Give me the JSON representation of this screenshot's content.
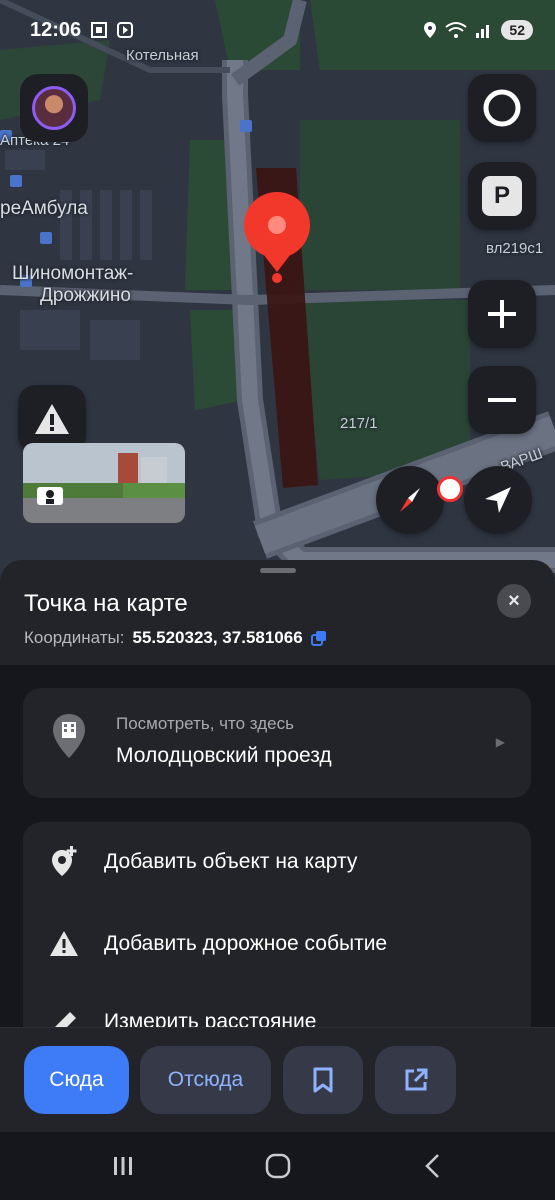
{
  "status_bar": {
    "time": "12:06",
    "battery": "52"
  },
  "map": {
    "labels": {
      "boiler": "Котельная",
      "pharmacy": "Аптека 24",
      "ambula": "реАмбула",
      "tire1": "Шиномонтаж-",
      "tire2": "Дрожжино",
      "building1": "вл219с1",
      "building2": "217/1",
      "road": "ВАРШ"
    },
    "colors": {
      "pin": "#f2372b",
      "highlight": "#3a1512"
    }
  },
  "sheet": {
    "title": "Точка на карте",
    "coords_label": "Координаты:",
    "coords_value": "55.520323, 37.581066",
    "close_label": "×",
    "what_here": {
      "subtitle": "Посмотреть, что здесь",
      "title": "Молодцовский проезд"
    },
    "actions": [
      {
        "label": "Добавить объект на карту",
        "icon": "add-place-icon"
      },
      {
        "label": "Добавить дорожное событие",
        "icon": "warning-icon"
      },
      {
        "label": "Измерить расстояние",
        "icon": "ruler-icon"
      }
    ]
  },
  "action_bar": {
    "to_here": "Сюда",
    "from_here": "Отсюда",
    "bookmark_icon": "bookmark-icon",
    "share_icon": "share-icon"
  },
  "accent_color": "#3d7bf7"
}
